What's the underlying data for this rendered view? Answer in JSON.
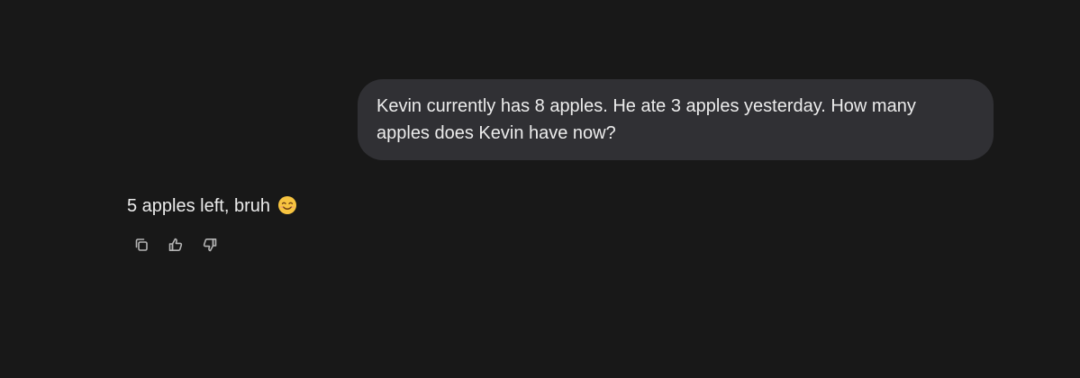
{
  "conversation": {
    "user_message": "Kevin currently has 8 apples. He ate 3 apples yesterday. How many apples does Kevin have now?",
    "assistant_message": "5 apples left, bruh",
    "assistant_emoji": "smiling-face-emoji"
  },
  "actions": {
    "copy_icon": "copy-icon",
    "like_icon": "thumbs-up-icon",
    "dislike_icon": "thumbs-down-icon"
  },
  "colors": {
    "background": "#181818",
    "user_bubble": "#303034",
    "text": "#ececec",
    "icon": "#b4b4b4"
  }
}
